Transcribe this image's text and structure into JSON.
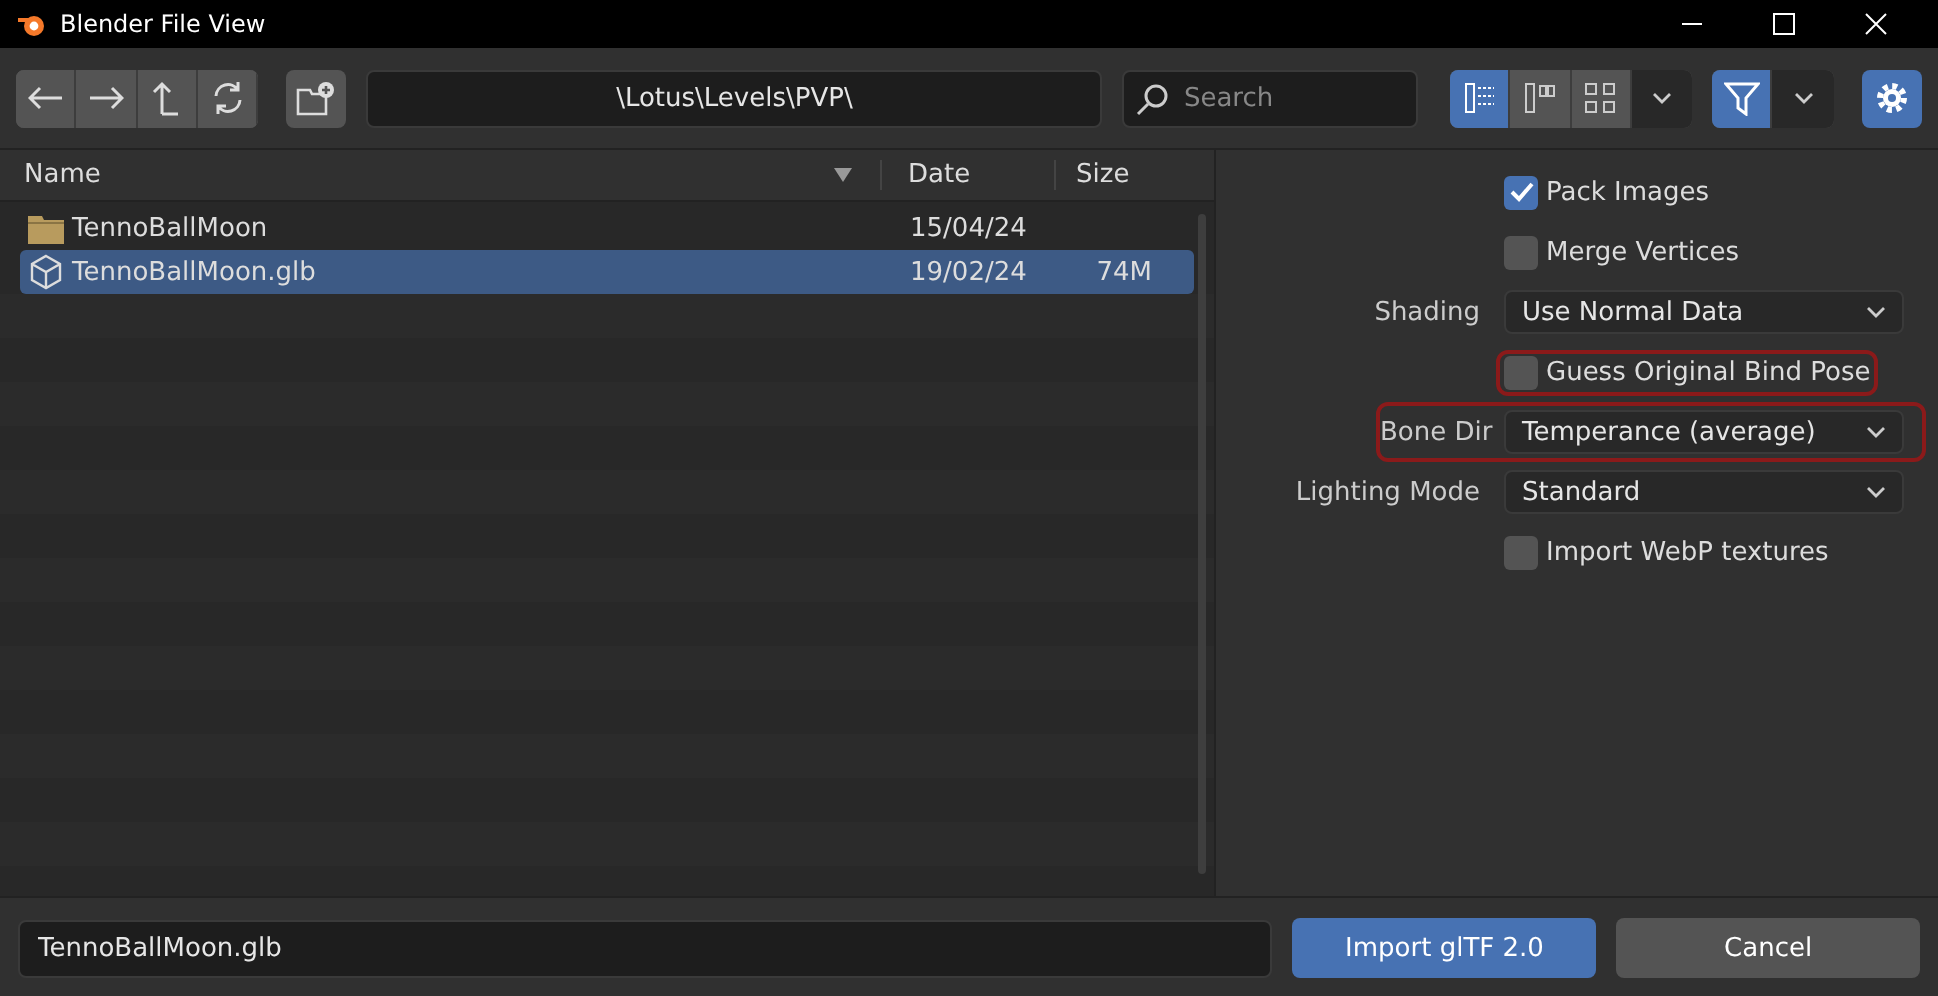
{
  "window": {
    "title": "Blender File View"
  },
  "toolbar": {
    "path": "\\Lotus\\Levels\\PVP\\",
    "search": {
      "placeholder": "Search"
    },
    "view_modes": [
      {
        "selected": true
      },
      {
        "selected": false
      },
      {
        "selected": false
      }
    ],
    "filter": {
      "on": true
    }
  },
  "table": {
    "columns": [
      "Name",
      "Date",
      "Size"
    ],
    "rows": [
      {
        "kind": "folder",
        "name": "TennoBallMoon",
        "date": "15/04/24",
        "size": "",
        "selected": false
      },
      {
        "kind": "file",
        "name": "TennoBallMoon.glb",
        "date": "19/02/24",
        "size": "74M",
        "selected": true
      }
    ]
  },
  "options": [
    {
      "kind": "checkbox",
      "label": "Pack Images",
      "checked": true,
      "highlighted": false
    },
    {
      "kind": "checkbox",
      "label": "Merge Vertices",
      "checked": false,
      "highlighted": false
    },
    {
      "kind": "dropdown",
      "label": "Shading",
      "value": "Use Normal Data",
      "highlighted": false
    },
    {
      "kind": "checkbox",
      "label": "Guess Original Bind Pose",
      "checked": false,
      "highlighted": true
    },
    {
      "kind": "dropdown",
      "label": "Bone Dir",
      "value": "Temperance (average)",
      "highlighted": true
    },
    {
      "kind": "dropdown",
      "label": "Lighting Mode",
      "value": "Standard",
      "highlighted": false
    },
    {
      "kind": "checkbox",
      "label": "Import WebP textures",
      "checked": false,
      "highlighted": false
    }
  ],
  "footer": {
    "filename": "TennoBallMoon.glb",
    "buttons": [
      {
        "kind": "primary",
        "label": "Import glTF 2.0"
      },
      {
        "kind": "secondary",
        "label": "Cancel"
      }
    ]
  }
}
